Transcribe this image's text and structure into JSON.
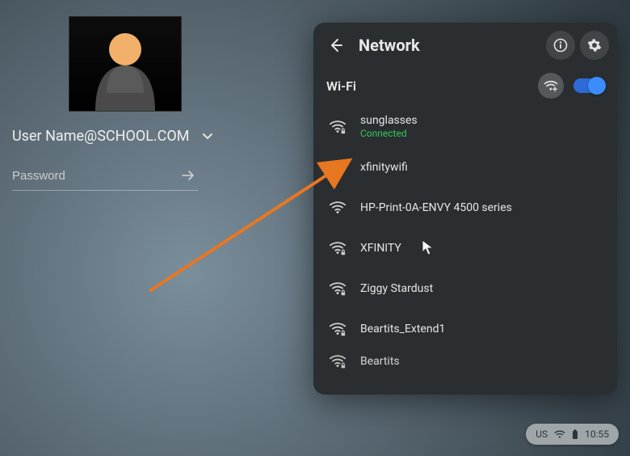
{
  "login": {
    "username": "User Name@SCHOOL.COM",
    "password_placeholder": "Password"
  },
  "panel": {
    "title": "Network",
    "wifi_label": "Wi-Fi",
    "wifi_on": true
  },
  "networks": [
    {
      "name": "sunglasses",
      "status": "Connected",
      "secured": true
    },
    {
      "name": "xfinitywifi",
      "status": "",
      "secured": false
    },
    {
      "name": "HP-Print-0A-ENVY 4500 series",
      "status": "",
      "secured": false
    },
    {
      "name": "XFINITY",
      "status": "",
      "secured": true
    },
    {
      "name": "Ziggy Stardust",
      "status": "",
      "secured": true
    },
    {
      "name": "Beartits_Extend1",
      "status": "",
      "secured": true
    },
    {
      "name": "Beartits",
      "status": "",
      "secured": true
    }
  ],
  "status": {
    "locale": "US",
    "time": "10:55"
  },
  "colors": {
    "connected": "#34c759",
    "accent": "#3b8dff",
    "arrow": "#e87722"
  }
}
